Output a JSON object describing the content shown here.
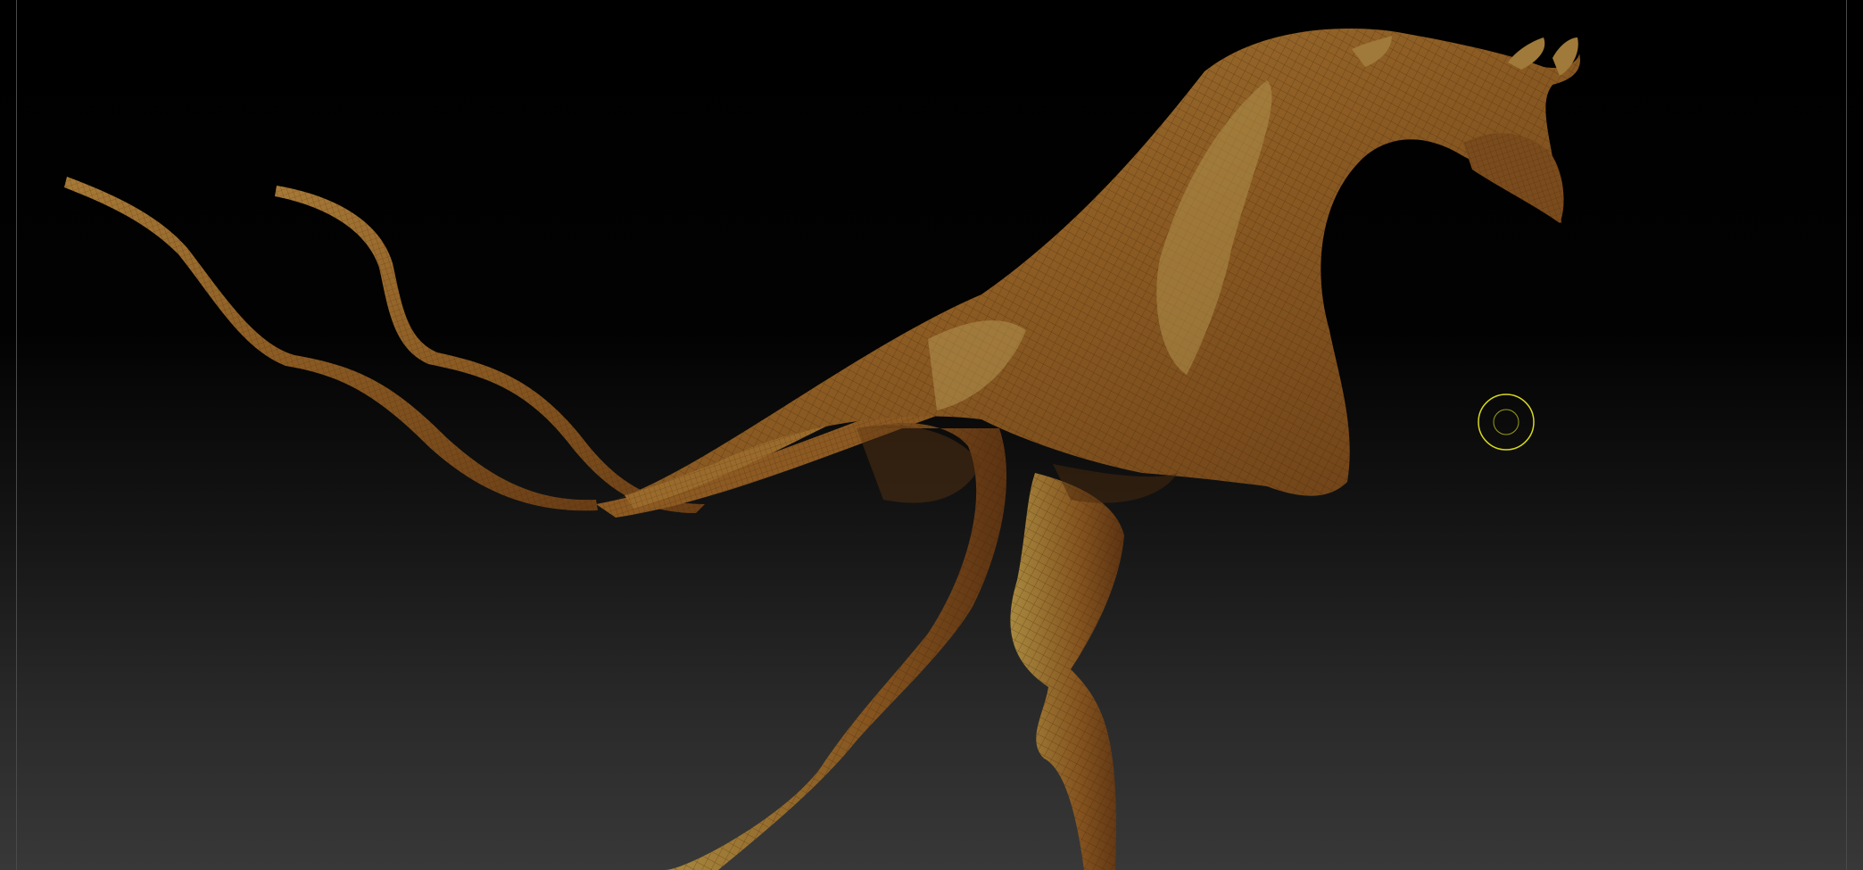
{
  "viewport": {
    "background_top": "#000000",
    "background_bottom": "#383838",
    "frame_line": "#4a4a4a"
  },
  "model": {
    "description_icon": "creature-mesh-icon",
    "base_color": "#8a5a22",
    "light_color": "#b0914c",
    "shadow_color": "#5e3512",
    "wire_color": "#3a1d08"
  },
  "brush_cursor": {
    "icon": "brush-circle-icon",
    "color": "#d8d820"
  }
}
